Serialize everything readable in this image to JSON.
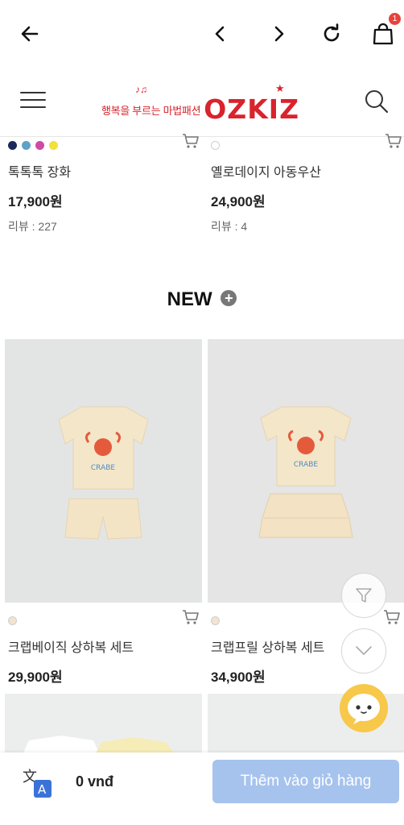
{
  "topbar": {
    "cart_count": "1"
  },
  "header": {
    "logo_tagline": "행복을 부르는 마법패션",
    "logo_word": "OZKIZ"
  },
  "top_products": [
    {
      "name": "톡톡톡 장화",
      "price": "17,900원",
      "review": "리뷰 : 227",
      "colors": [
        "#1b2a5a",
        "#5fa2c8",
        "#cf4aa6",
        "#f0e23a"
      ]
    },
    {
      "name": "옐로데이지 아동우산",
      "price": "24,900원",
      "review": "리뷰 : 4",
      "colors": []
    }
  ],
  "section": {
    "title": "NEW"
  },
  "new_products": [
    {
      "name": "크랩베이직 상하복 세트",
      "price": "29,900원",
      "image_text": "CRABE"
    },
    {
      "name": "크랩프릴 상하복 세트",
      "price": "34,900원",
      "image_text": "CRABE"
    }
  ],
  "bottombar": {
    "total": "0 vnđ",
    "add_to_cart_label": "Thêm vào giỏ hàng"
  },
  "icons": {
    "back": "arrow-left-icon",
    "prev": "chevron-left-icon",
    "next": "chevron-right-icon",
    "reload": "reload-icon",
    "bag": "shopping-bag-icon",
    "menu": "hamburger-menu-icon",
    "search": "search-icon",
    "cart": "cart-icon",
    "filter": "filter-icon",
    "scroll": "chevron-down-icon",
    "chat": "chatbot-icon",
    "translate": "translate-icon"
  },
  "colors": {
    "brand": "#d9232d",
    "button_disabled": "#a6c3ee",
    "badge": "#e8423a"
  }
}
